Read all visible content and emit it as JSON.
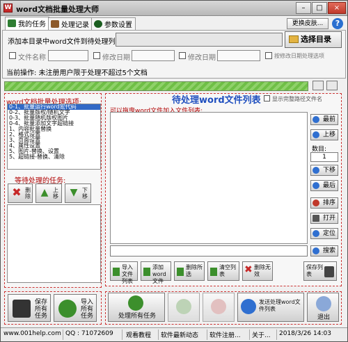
{
  "window": {
    "title": "word文档批量处理大师",
    "controls": [
      "–",
      "□",
      "×"
    ]
  },
  "tabs": [
    {
      "label": "我的任务",
      "icon": "task-icon",
      "color": "#2e7d32"
    },
    {
      "label": "处理记录",
      "icon": "record-icon",
      "color": "#8d5a2b"
    },
    {
      "label": "参数设置",
      "icon": "settings-icon",
      "color": "#1b5e20"
    }
  ],
  "header": {
    "skin_button": "更换皮肤...",
    "add_dir_label": "添加本目录中word文件到待处理列表:",
    "select_dir_button": "选择目录",
    "filters": [
      {
        "label": "文件名称"
      },
      {
        "label": "修改日期"
      },
      {
        "label": "修改日期"
      },
      {
        "label": "按修改日期处理选项"
      }
    ],
    "current_op": "当前操作: 未注册用户限于处理不超过5个文档"
  },
  "options": {
    "title": "word文档批量处理选项:",
    "items": [
      "0-1、批量运行word宏代码",
      "0-2、批量版权/随机文字",
      "0-3、批量随机版权图片",
      "0-4、批量添加文字超链接",
      "1、内容批量替换",
      "2、格式设置",
      "3、页面设置",
      "4、属性设置",
      "5、图片-替换、设置",
      "5、超链接-替换、清除"
    ],
    "selected_index": 0,
    "waiting_title": "等待处理的任务:",
    "task_buttons": [
      "删除",
      "上移",
      "下移"
    ]
  },
  "files": {
    "title": "待处理word文件列表",
    "show_path_label": "显示完整路径文件名",
    "hint": "可以拖曳word文件加入文件列表:",
    "side_buttons": [
      "最前",
      "上移",
      "下移",
      "最后",
      "排序",
      "打开",
      "定位",
      "搜索"
    ],
    "index_label": "数目:",
    "index_value": "1",
    "bottom_buttons": [
      "导入文件列表",
      "添加word文件",
      "删除所选",
      "清空列表",
      "删除无效",
      "保存列表"
    ]
  },
  "bottom": {
    "save_all": "保存所有任务",
    "import_all": "导入所有任务",
    "process_all": "处理所有任务",
    "btn4": "",
    "btn5": "",
    "send_list": "发送处理word文件列表",
    "exit": "退出"
  },
  "statusbar": {
    "site": "www.001help.com",
    "qq": "QQ : 71072609",
    "tutorial": "观看教程",
    "news": "软件最新动态",
    "register": "软件注册...",
    "about": "关于...",
    "datetime": "2018/3/26 14:03"
  }
}
